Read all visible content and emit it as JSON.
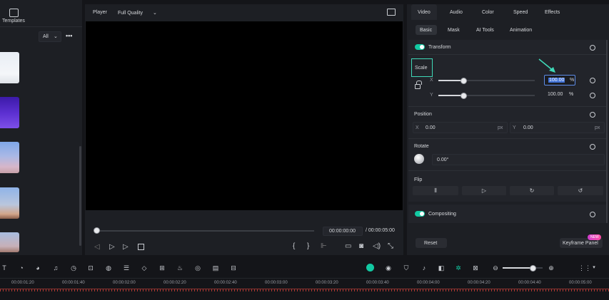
{
  "left_panel": {
    "templates_label": "Templates",
    "filter_value": "All",
    "more_icon": "more-horizontal-icon",
    "templates_icon": "templates-icon"
  },
  "player": {
    "label": "Player",
    "quality": "Full Quality",
    "current_time": "00:00:00:00",
    "total_time": "/ 00:00:05:00"
  },
  "properties": {
    "main_tabs": [
      "Video",
      "Audio",
      "Color",
      "Speed",
      "Effects"
    ],
    "active_main_tab": "Video",
    "sub_tabs": [
      "Basic",
      "Mask",
      "AI Tools",
      "Animation"
    ],
    "active_sub_tab": "Basic",
    "transform_label": "Transform",
    "scale_label": "Scale",
    "scale_x_label": "X",
    "scale_y_label": "Y",
    "scale_x_value": "100.00",
    "scale_y_value": "100.00",
    "scale_unit": "%",
    "scale_x_level": 0.26,
    "scale_y_level": 0.26,
    "position_label": "Position",
    "pos_x_label": "X",
    "pos_x_value": "0.00",
    "pos_y_label": "Y",
    "pos_y_value": "0.00",
    "pos_unit": "px",
    "rotate_label": "Rotate",
    "rotate_value": "0.00°",
    "flip_label": "Flip",
    "compositing_label": "Compositing",
    "reset_label": "Reset",
    "keyframe_label": "Keyframe Panel",
    "new_badge": "NEW"
  },
  "timeline": {
    "ruler": [
      "00:00:01:20",
      "00:00:01:40",
      "00:00:02:00",
      "00:00:02:20",
      "00:00:02:40",
      "00:00:03:00",
      "00:00:03:20",
      "00:00:03:40",
      "00:00:04:00",
      "00:00:04:20",
      "00:00:04:40",
      "00:00:05:00"
    ],
    "zoom_level": 0.75
  },
  "colors": {
    "accent": "#12c9a2",
    "highlight": "#3fd9b8",
    "selection": "#3d6fd6",
    "playhead": "#e0463d"
  }
}
